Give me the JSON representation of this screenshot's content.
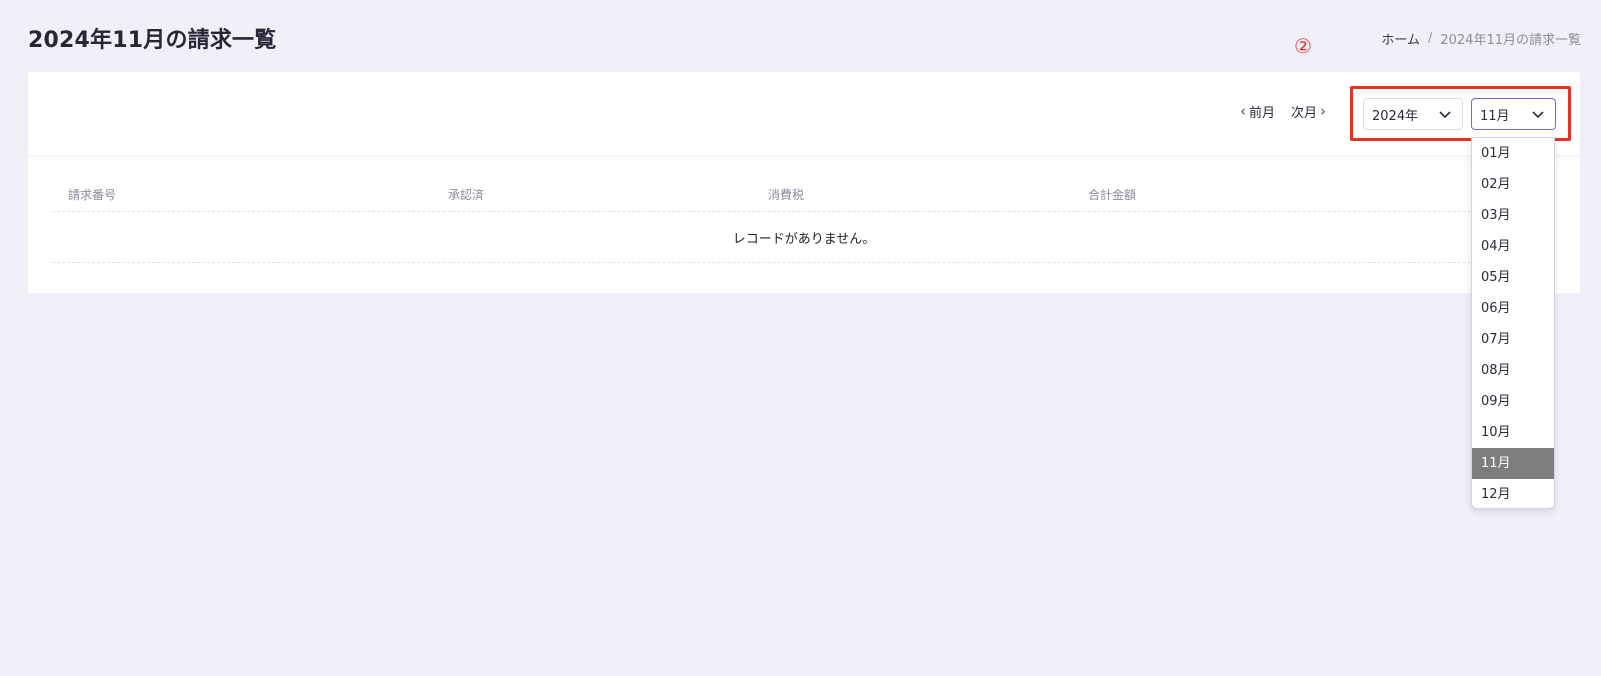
{
  "page": {
    "title": "2024年11月の請求一覧"
  },
  "breadcrumb": {
    "home": "ホーム",
    "separator": "/",
    "current": "2024年11月の請求一覧"
  },
  "annotation": {
    "number": "②",
    "color": "#e53223"
  },
  "toolbar": {
    "prev_label": "前月",
    "next_label": "次月",
    "year_value": "2024年",
    "month_value": "11月"
  },
  "table": {
    "columns": [
      "請求番号",
      "承認済",
      "消費税",
      "合計金額"
    ],
    "empty_message": "レコードがありません。"
  },
  "month_dropdown": {
    "options": [
      "01月",
      "02月",
      "03月",
      "04月",
      "05月",
      "06月",
      "07月",
      "08月",
      "09月",
      "10月",
      "11月",
      "12月"
    ],
    "selected": "11月",
    "selected_bg": "#7d7d7d"
  }
}
